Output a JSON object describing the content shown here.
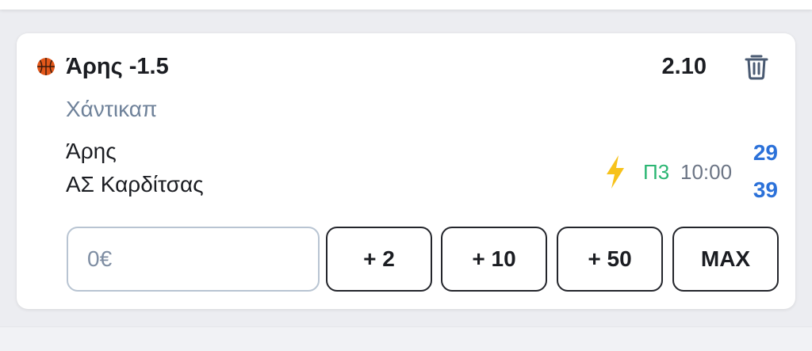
{
  "colors": {
    "accent_blue": "#2b71d9",
    "period_green": "#2bb673",
    "bolt_yellow": "#f7c21b",
    "basketball_orange": "#e2571a",
    "muted_text": "#6f829a"
  },
  "bet": {
    "sport_icon": "basketball-icon",
    "selection": "Άρης -1.5",
    "odds": "2.10",
    "market": "Χάντικαπ",
    "home_team": "Άρης",
    "away_team": "ΑΣ Καρδίτσας",
    "live_icon": "lightning-bolt-icon",
    "period": "Π3",
    "clock": "10:00",
    "home_score": "29",
    "away_score": "39",
    "delete_icon": "trash-icon"
  },
  "stake": {
    "value": "0€"
  },
  "quick_stakes": [
    "+ 2",
    "+ 10",
    "+ 50",
    "MAX"
  ]
}
